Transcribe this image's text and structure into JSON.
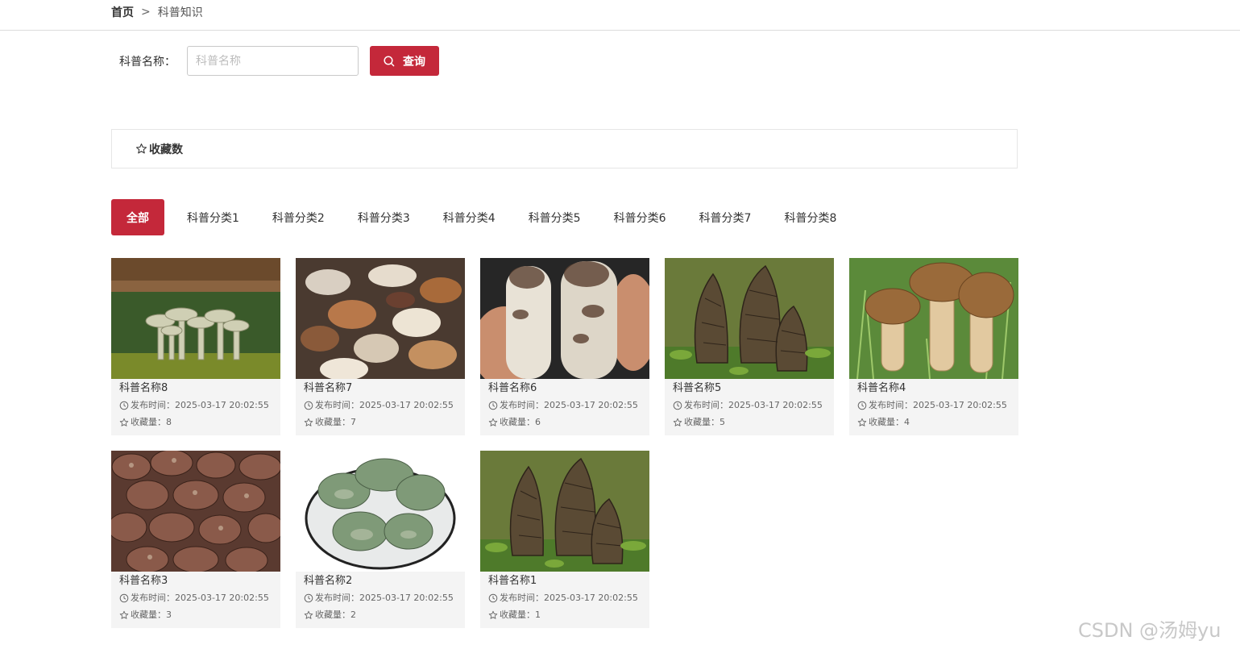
{
  "breadcrumb": {
    "home": "首页",
    "separator": ">",
    "current": "科普知识"
  },
  "search": {
    "label": "科普名称：",
    "placeholder": "科普名称",
    "value": "",
    "button_label": "查询",
    "icon": "search-icon"
  },
  "sort": {
    "label": "收藏数",
    "icon": "star-icon"
  },
  "categories": [
    "全部",
    "科普分类1",
    "科普分类2",
    "科普分类3",
    "科普分类4",
    "科普分类5",
    "科普分类6",
    "科普分类7",
    "科普分类8"
  ],
  "active_category": "全部",
  "colors": {
    "accent": "#c4283a",
    "card_bg": "#f4f4f4",
    "border": "#e6e6e6"
  },
  "items": [
    {
      "title": "科普名称8",
      "time_label": "发布时间：",
      "time": "2025-03-17 20:02:55",
      "fav_label": "收藏量：",
      "fav": "8",
      "image": "white-clustered-mushrooms"
    },
    {
      "title": "科普名称7",
      "time_label": "发布时间：",
      "time": "2025-03-17 20:02:55",
      "fav_label": "收藏量：",
      "fav": "7",
      "image": "mixed-wild-mushrooms"
    },
    {
      "title": "科普名称6",
      "time_label": "发布时间：",
      "time": "2025-03-17 20:02:55",
      "fav_label": "收藏量：",
      "fav": "6",
      "image": "matsutake-in-hand"
    },
    {
      "title": "科普名称5",
      "time_label": "发布时间：",
      "time": "2025-03-17 20:02:55",
      "fav_label": "收藏量：",
      "fav": "5",
      "image": "morel-mushrooms"
    },
    {
      "title": "科普名称4",
      "time_label": "发布时间：",
      "time": "2025-03-17 20:02:55",
      "fav_label": "收藏量：",
      "fav": "4",
      "image": "porcini-in-grass"
    },
    {
      "title": "科普名称3",
      "time_label": "发布时间：",
      "time": "2025-03-17 20:02:55",
      "fav_label": "收藏量：",
      "fav": "3",
      "image": "shiitake-pile"
    },
    {
      "title": "科普名称2",
      "time_label": "发布时间：",
      "time": "2025-03-17 20:02:55",
      "fav_label": "收藏量：",
      "fav": "2",
      "image": "green-mushrooms-on-plate"
    },
    {
      "title": "科普名称1",
      "time_label": "发布时间：",
      "time": "2025-03-17 20:02:55",
      "fav_label": "收藏量：",
      "fav": "1",
      "image": "morel-mushrooms"
    }
  ],
  "watermark": "CSDN @汤姆yu"
}
